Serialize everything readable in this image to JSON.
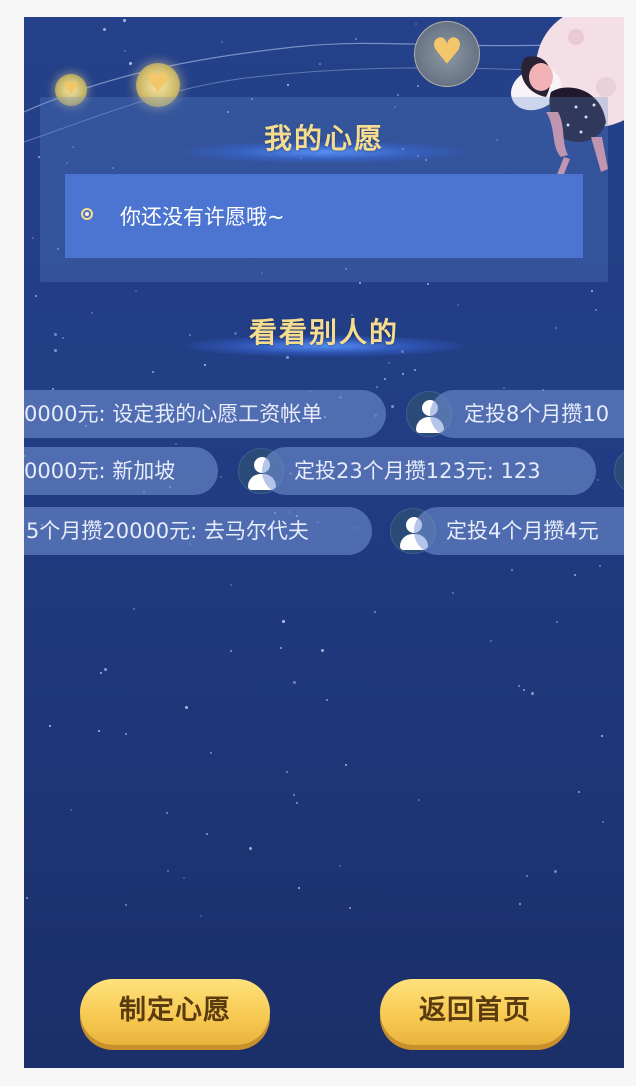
{
  "my_wish": {
    "title": "我的心愿",
    "empty_text": "你还没有许愿哦~"
  },
  "others": {
    "title": "看看别人的",
    "rows": [
      [
        "0000元: 设定我的心愿工资帐单",
        "定投8个月攒10"
      ],
      [
        "0000元: 新加坡",
        "定投23个月攒123元: 123"
      ],
      [
        "5个月攒20000元: 去马尔代夫",
        "定投4个月攒4元"
      ]
    ]
  },
  "buttons": {
    "make_wish": "制定心愿",
    "back_home": "返回首页"
  },
  "colors": {
    "background_top": "#24418a",
    "background_bottom": "#1b2f68",
    "title_gold": "#f5dc8e",
    "wish_box": "#4c75d2",
    "button_gold": "#f6c84f"
  },
  "icons": [
    "heart-icon",
    "avatar-icon",
    "radio-icon",
    "sleeping-girl-illustration"
  ]
}
